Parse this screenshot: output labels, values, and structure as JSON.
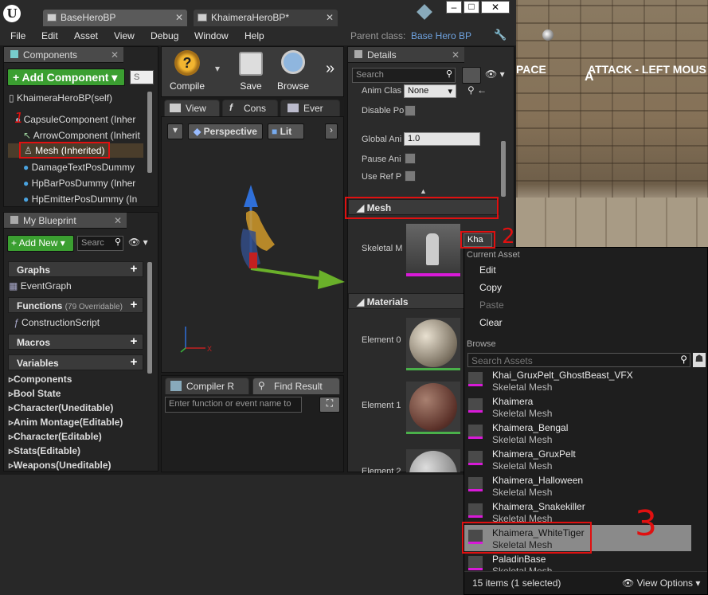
{
  "window": {
    "tabs": [
      {
        "label": "BaseHeroBP"
      },
      {
        "label": "KhaimeraHeroBP*"
      }
    ],
    "menu": [
      "File",
      "Edit",
      "Asset",
      "View",
      "Debug",
      "Window",
      "Help"
    ],
    "parent_class_label": "Parent class:",
    "parent_class_value": "Base Hero BP"
  },
  "components": {
    "title": "Components",
    "add_button": "+ Add Component",
    "search_placeholder": "S",
    "tree": [
      {
        "label": "KhaimeraHeroBP(self)"
      },
      {
        "label": "CapsuleComponent (Inher"
      },
      {
        "label": "ArrowComponent (Inherit"
      },
      {
        "label": "Mesh (Inherited)"
      },
      {
        "label": "DamageTextPosDummy"
      },
      {
        "label": "HpBarPosDummy (Inher"
      },
      {
        "label": "HpEmitterPosDummy (In"
      }
    ]
  },
  "blueprint": {
    "title": "My Blueprint",
    "add_new": "+ Add New",
    "search_placeholder": "Searc",
    "graphs_label": "Graphs",
    "event_graph": "EventGraph",
    "functions_label": "Functions",
    "functions_count": "(79 Overridable)",
    "construction_script": "ConstructionScript",
    "macros_label": "Macros",
    "variables_label": "Variables",
    "variables": [
      "Components",
      "Bool State",
      "Character(Uneditable)",
      "Anim Montage(Editable)",
      "Character(Editable)",
      "Stats(Editable)",
      "Weapons(Uneditable)"
    ]
  },
  "toolbar": {
    "compile": "Compile",
    "save": "Save",
    "browse": "Browse"
  },
  "viewport": {
    "tabs": [
      "View",
      "Cons",
      "Ever"
    ],
    "perspective": "Perspective",
    "lit": "Lit"
  },
  "bottom": {
    "tabs": [
      "Compiler R",
      "Find Result"
    ],
    "search_placeholder": "Enter function or event name to"
  },
  "details": {
    "title": "Details",
    "search_placeholder": "Search",
    "anim_class_label": "Anim Clas",
    "anim_class_value": "None",
    "disable_label": "Disable Po",
    "global_anim_label": "Global Ani",
    "global_anim_value": "1.0",
    "pause_label": "Pause Ani",
    "use_ref_label": "Use Ref P",
    "mesh_section": "Mesh",
    "skeletal_label": "Skeletal M",
    "mesh_dropdown": "Kha",
    "materials_section": "Materials",
    "element_0": "Element 0",
    "element_1": "Element 1",
    "element_2": "Element 2"
  },
  "game_view": {
    "hud_text_1": "PACE",
    "hud_text_2": "ATTACK - LEFT MOUS",
    "hud_letter": "A"
  },
  "popup": {
    "current_asset_label": "Current Asset",
    "actions": [
      "Edit",
      "Copy",
      "Paste",
      "Clear"
    ],
    "browse_label": "Browse",
    "search_placeholder": "Search Assets",
    "assets": [
      {
        "name": "Khai_GruxPelt_GhostBeast_VFX",
        "type": "Skeletal Mesh"
      },
      {
        "name": "Khaimera",
        "type": "Skeletal Mesh"
      },
      {
        "name": "Khaimera_Bengal",
        "type": "Skeletal Mesh"
      },
      {
        "name": "Khaimera_GruxPelt",
        "type": "Skeletal Mesh"
      },
      {
        "name": "Khaimera_Halloween",
        "type": "Skeletal Mesh"
      },
      {
        "name": "Khaimera_Snakekiller",
        "type": "Skeletal Mesh"
      },
      {
        "name": "Khaimera_WhiteTiger",
        "type": "Skeletal Mesh"
      },
      {
        "name": "PaladinBase",
        "type": "Skeletal Mesh"
      }
    ],
    "status": "15 items (1 selected)",
    "view_options": "View Options"
  },
  "annotations": {
    "n1": "1",
    "n2": "2",
    "n3": "3"
  }
}
